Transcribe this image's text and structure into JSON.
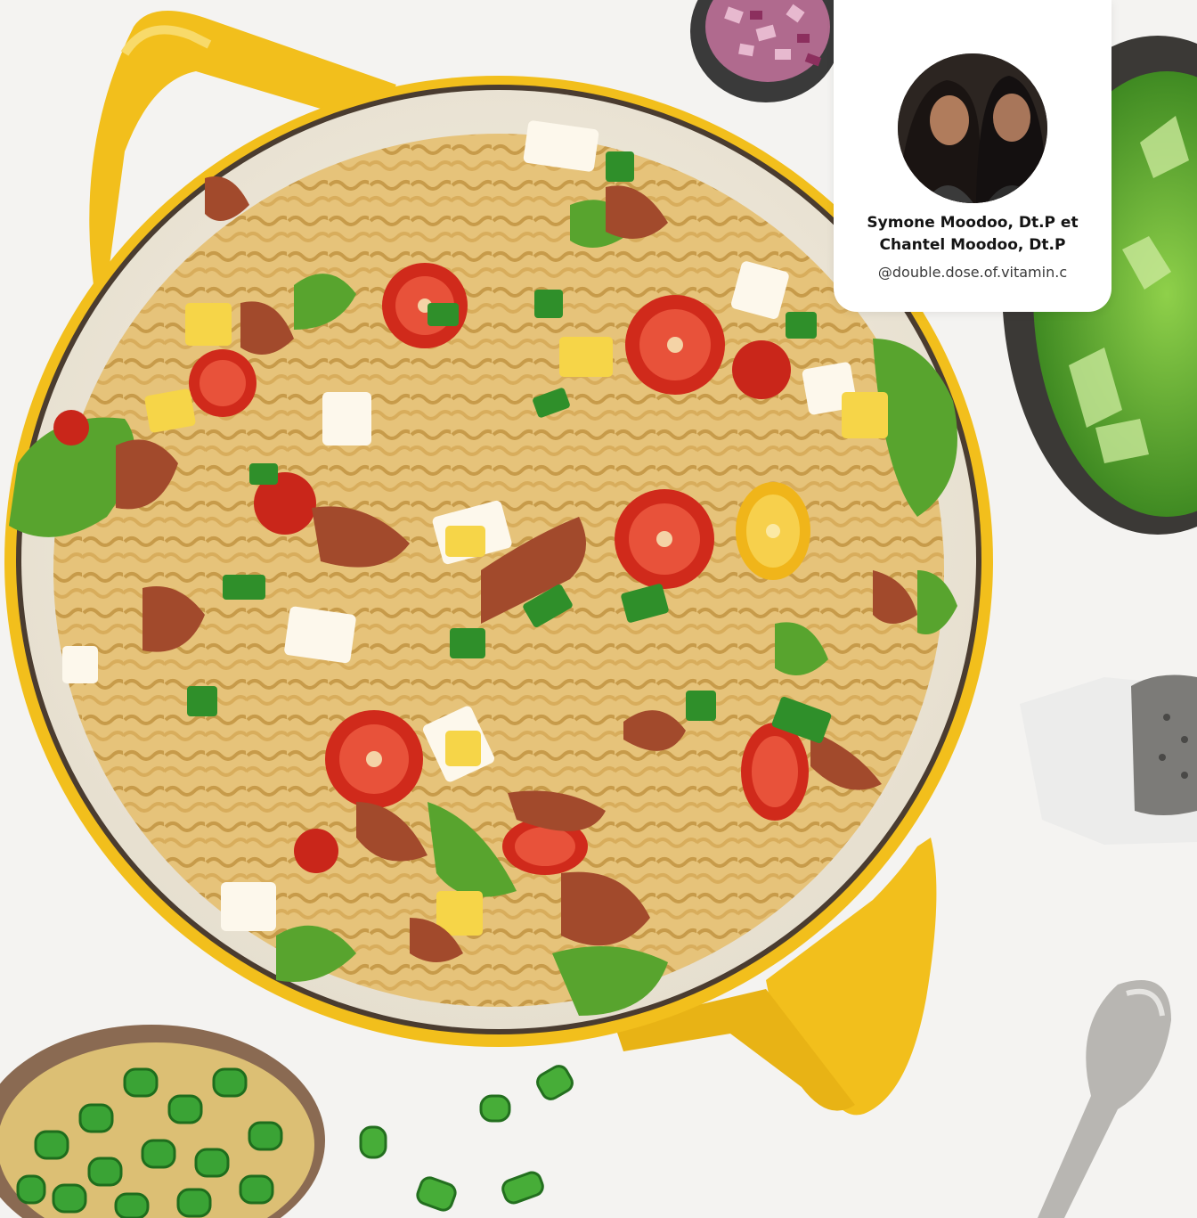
{
  "author": {
    "name_line1": "Symone Moodoo, Dt.P et",
    "name_line2": "Chantel Moodoo, Dt.P",
    "handle": "@double.dose.of.vitamin.c"
  },
  "colors": {
    "background": "#f4f3f1",
    "pot_yellow": "#f2bf1c",
    "pot_rim": "#ece6da",
    "pasta": "#e9c678",
    "tomato": "#c8261a",
    "lettuce": "#4f9a2c",
    "green_onion": "#2f8f2a",
    "egg_yolk": "#f5d24a"
  }
}
